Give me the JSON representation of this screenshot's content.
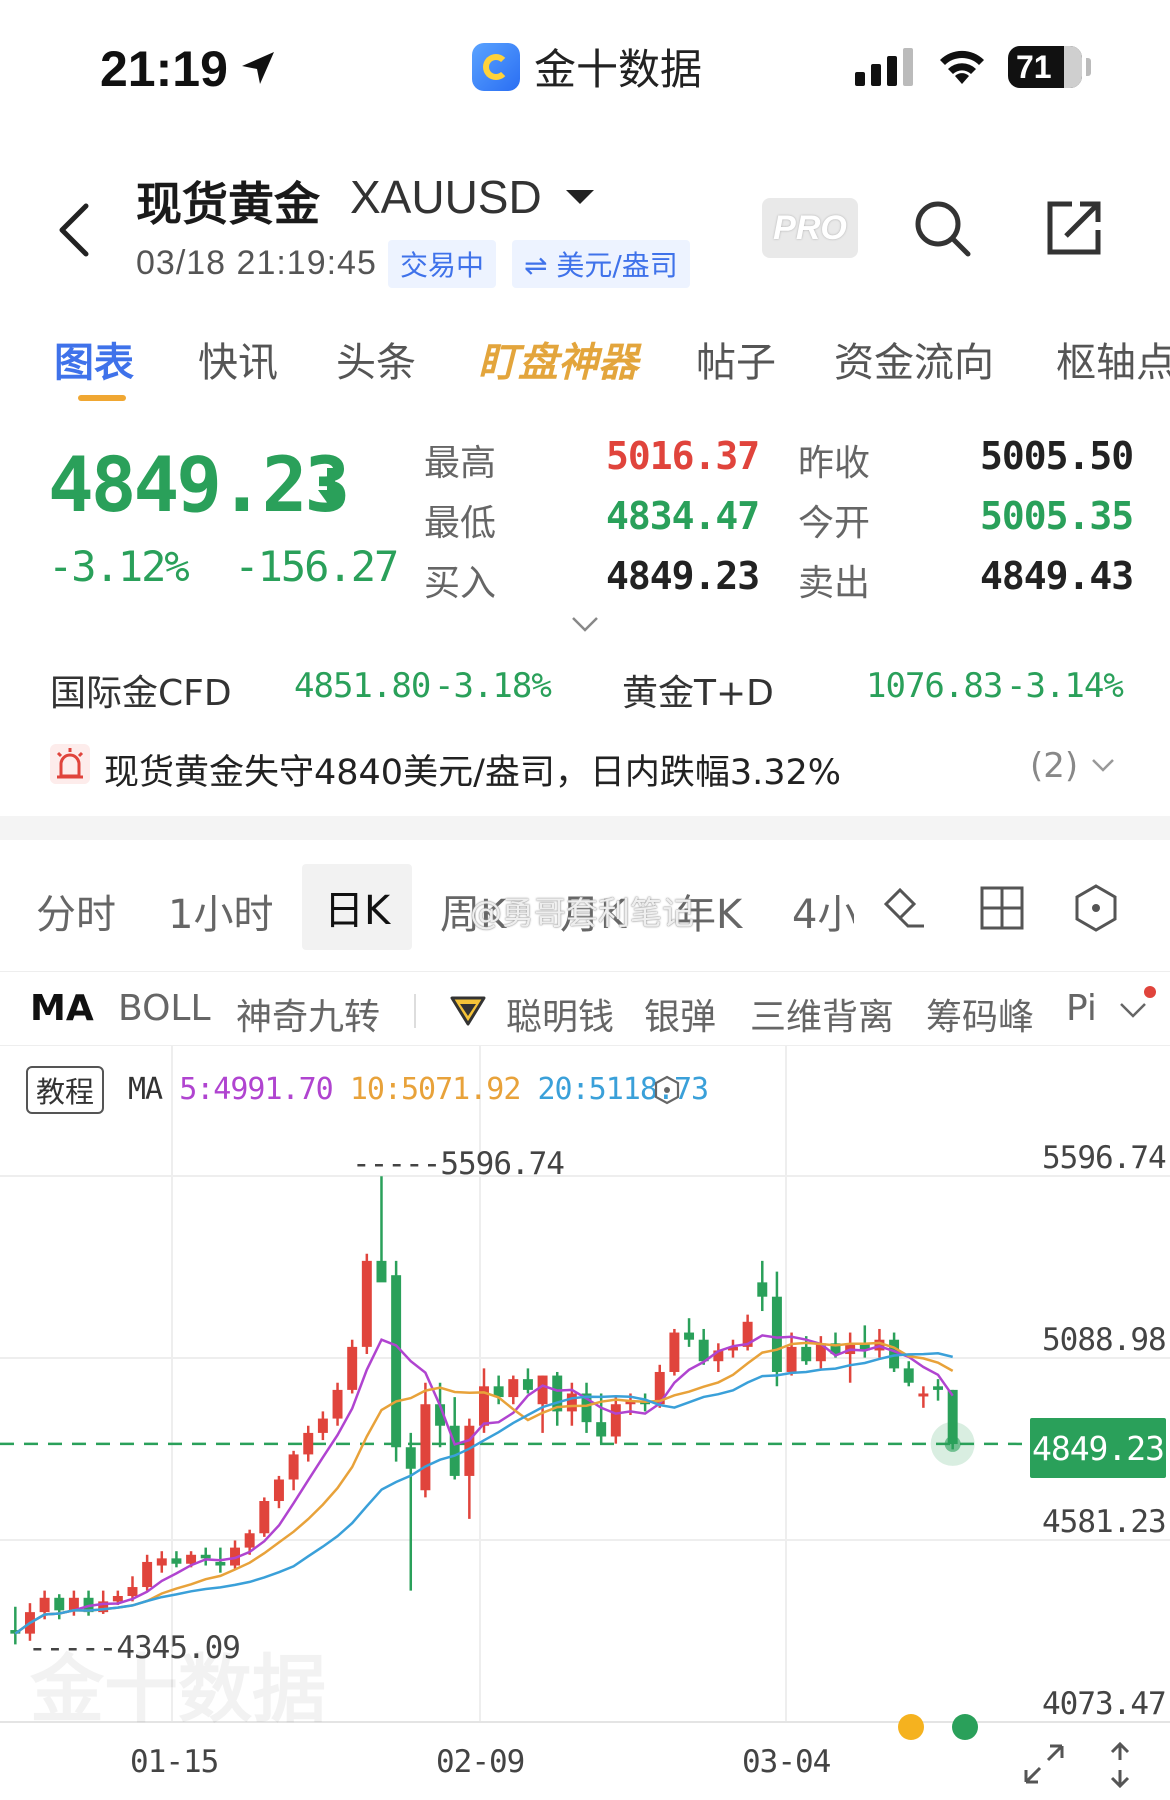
{
  "status_bar": {
    "time": "21:19",
    "app_name": "金十数据",
    "battery": "71"
  },
  "header": {
    "name": "现货黄金",
    "code": "XAUUSD",
    "datetime": "03/18 21:19:45",
    "status_tag": "交易中",
    "unit_tag": "⇌ 美元/盎司",
    "pro_label": "PRO"
  },
  "tabs": [
    {
      "label": "图表"
    },
    {
      "label": "快讯"
    },
    {
      "label": "头条"
    },
    {
      "label": "盯盘神器"
    },
    {
      "label": "帖子"
    },
    {
      "label": "资金流向"
    },
    {
      "label": "枢轴点"
    }
  ],
  "quote": {
    "price": "4849.23",
    "change_pct": "-3.12%",
    "change_abs": "-156.27",
    "stats": [
      {
        "label": "最高",
        "value": "5016.37",
        "color": "#e0443c"
      },
      {
        "label": "最低",
        "value": "4834.47",
        "color": "#2aa05a"
      },
      {
        "label": "买入",
        "value": "4849.23",
        "color": "#222222"
      },
      {
        "label": "昨收",
        "value": "5005.50",
        "color": "#222222"
      },
      {
        "label": "今开",
        "value": "5005.35",
        "color": "#2aa05a"
      },
      {
        "label": "卖出",
        "value": "4849.43",
        "color": "#222222"
      }
    ]
  },
  "related": [
    {
      "name": "国际金CFD",
      "price": "4851.80",
      "change": "-3.18%"
    },
    {
      "name": "黄金T+D",
      "price": "1076.83",
      "change": "-3.14%"
    }
  ],
  "news": {
    "text": "现货黄金失守4840美元/盎司，日内跌幅3.32%",
    "count": "(2)"
  },
  "periods": [
    {
      "label": "分时"
    },
    {
      "label": "1小时"
    },
    {
      "label": "日K"
    },
    {
      "label": "周K"
    },
    {
      "label": "月K"
    },
    {
      "label": "年K"
    },
    {
      "label": "4小"
    }
  ],
  "watermark_text": "@勇哥套利笔记",
  "indicators": [
    {
      "label": "MA"
    },
    {
      "label": "BOLL"
    },
    {
      "label": "神奇九转"
    },
    {
      "label": "聪明钱"
    },
    {
      "label": "银弹"
    },
    {
      "label": "三维背离"
    },
    {
      "label": "筹码峰"
    },
    {
      "label": "Pi"
    }
  ],
  "chart_legend": {
    "tutorial": "教程",
    "ma_label": "MA",
    "ma5": "5:4991.70",
    "ma10": "10:5071.92",
    "ma20": "20:5118.73"
  },
  "chart_watermark": "金十数据",
  "chart_data": {
    "type": "candlestick",
    "y_ticks": [
      "5596.74",
      "5088.98",
      "4581.23",
      "4073.47"
    ],
    "ylim": [
      4073.47,
      5596.74
    ],
    "x_ticks": [
      "01-15",
      "02-09",
      "03-04"
    ],
    "high_label": "5596.74",
    "low_label": "4345.09",
    "last_price": "4849.23",
    "last_price_value": 4849.23,
    "colors": {
      "up": "#e0443c",
      "down": "#2aa05a",
      "ma5": "#b044d0",
      "ma10": "#e8a23a",
      "ma20": "#3aa0d9"
    },
    "candles": [
      {
        "o": 4330,
        "h": 4395,
        "l": 4290,
        "c": 4320
      },
      {
        "o": 4320,
        "h": 4405,
        "l": 4300,
        "c": 4380
      },
      {
        "o": 4380,
        "h": 4440,
        "l": 4360,
        "c": 4420
      },
      {
        "o": 4420,
        "h": 4430,
        "l": 4360,
        "c": 4385
      },
      {
        "o": 4385,
        "h": 4440,
        "l": 4370,
        "c": 4420
      },
      {
        "o": 4420,
        "h": 4440,
        "l": 4370,
        "c": 4380
      },
      {
        "o": 4380,
        "h": 4440,
        "l": 4375,
        "c": 4410
      },
      {
        "o": 4410,
        "h": 4440,
        "l": 4400,
        "c": 4425
      },
      {
        "o": 4425,
        "h": 4480,
        "l": 4410,
        "c": 4450
      },
      {
        "o": 4450,
        "h": 4540,
        "l": 4440,
        "c": 4520
      },
      {
        "o": 4510,
        "h": 4550,
        "l": 4490,
        "c": 4530
      },
      {
        "o": 4530,
        "h": 4550,
        "l": 4505,
        "c": 4515
      },
      {
        "o": 4515,
        "h": 4550,
        "l": 4505,
        "c": 4540
      },
      {
        "o": 4540,
        "h": 4560,
        "l": 4510,
        "c": 4530
      },
      {
        "o": 4520,
        "h": 4560,
        "l": 4490,
        "c": 4510
      },
      {
        "o": 4510,
        "h": 4580,
        "l": 4500,
        "c": 4560
      },
      {
        "o": 4560,
        "h": 4610,
        "l": 4540,
        "c": 4600
      },
      {
        "o": 4600,
        "h": 4700,
        "l": 4590,
        "c": 4690
      },
      {
        "o": 4690,
        "h": 4760,
        "l": 4670,
        "c": 4750
      },
      {
        "o": 4750,
        "h": 4830,
        "l": 4720,
        "c": 4820
      },
      {
        "o": 4820,
        "h": 4900,
        "l": 4800,
        "c": 4880
      },
      {
        "o": 4880,
        "h": 4940,
        "l": 4860,
        "c": 4920
      },
      {
        "o": 4920,
        "h": 5020,
        "l": 4900,
        "c": 5000
      },
      {
        "o": 5000,
        "h": 5140,
        "l": 4990,
        "c": 5120
      },
      {
        "o": 5120,
        "h": 5380,
        "l": 5100,
        "c": 5360
      },
      {
        "o": 5360,
        "h": 5596,
        "l": 5310,
        "c": 5300
      },
      {
        "o": 5320,
        "h": 5360,
        "l": 4800,
        "c": 4840
      },
      {
        "o": 4840,
        "h": 4880,
        "l": 4440,
        "c": 4780
      },
      {
        "o": 4720,
        "h": 5020,
        "l": 4700,
        "c": 4960
      },
      {
        "o": 4960,
        "h": 5020,
        "l": 4840,
        "c": 4900
      },
      {
        "o": 4900,
        "h": 4980,
        "l": 4750,
        "c": 4760
      },
      {
        "o": 4760,
        "h": 4920,
        "l": 4640,
        "c": 4900
      },
      {
        "o": 4900,
        "h": 5060,
        "l": 4880,
        "c": 5010
      },
      {
        "o": 5010,
        "h": 5040,
        "l": 4960,
        "c": 4980
      },
      {
        "o": 4980,
        "h": 5040,
        "l": 4960,
        "c": 5030
      },
      {
        "o": 5030,
        "h": 5060,
        "l": 4990,
        "c": 5000
      },
      {
        "o": 4960,
        "h": 5040,
        "l": 4880,
        "c": 5040
      },
      {
        "o": 5040,
        "h": 5050,
        "l": 4900,
        "c": 4940
      },
      {
        "o": 4940,
        "h": 5020,
        "l": 4900,
        "c": 4990
      },
      {
        "o": 4990,
        "h": 5020,
        "l": 4880,
        "c": 4910
      },
      {
        "o": 4910,
        "h": 4990,
        "l": 4850,
        "c": 4870
      },
      {
        "o": 4870,
        "h": 4980,
        "l": 4850,
        "c": 4960
      },
      {
        "o": 4960,
        "h": 4990,
        "l": 4930,
        "c": 4970
      },
      {
        "o": 4970,
        "h": 4990,
        "l": 4940,
        "c": 4960
      },
      {
        "o": 4960,
        "h": 5070,
        "l": 4950,
        "c": 5050
      },
      {
        "o": 5050,
        "h": 5170,
        "l": 5040,
        "c": 5160
      },
      {
        "o": 5160,
        "h": 5200,
        "l": 5120,
        "c": 5140
      },
      {
        "o": 5140,
        "h": 5170,
        "l": 5070,
        "c": 5080
      },
      {
        "o": 5080,
        "h": 5130,
        "l": 5050,
        "c": 5110
      },
      {
        "o": 5110,
        "h": 5140,
        "l": 5090,
        "c": 5120
      },
      {
        "o": 5120,
        "h": 5210,
        "l": 5110,
        "c": 5190
      },
      {
        "o": 5300,
        "h": 5360,
        "l": 5220,
        "c": 5260
      },
      {
        "o": 5260,
        "h": 5330,
        "l": 5010,
        "c": 5050
      },
      {
        "o": 5050,
        "h": 5160,
        "l": 5040,
        "c": 5120
      },
      {
        "o": 5120,
        "h": 5150,
        "l": 5070,
        "c": 5080
      },
      {
        "o": 5080,
        "h": 5150,
        "l": 5060,
        "c": 5130
      },
      {
        "o": 5130,
        "h": 5160,
        "l": 5090,
        "c": 5100
      },
      {
        "o": 5100,
        "h": 5160,
        "l": 5020,
        "c": 5130
      },
      {
        "o": 5130,
        "h": 5180,
        "l": 5090,
        "c": 5110
      },
      {
        "o": 5110,
        "h": 5170,
        "l": 5090,
        "c": 5140
      },
      {
        "o": 5140,
        "h": 5160,
        "l": 5050,
        "c": 5060
      },
      {
        "o": 5060,
        "h": 5080,
        "l": 5010,
        "c": 5020
      },
      {
        "o": 4990,
        "h": 5010,
        "l": 4950,
        "c": 4990
      },
      {
        "o": 5010,
        "h": 5030,
        "l": 4970,
        "c": 5000
      },
      {
        "o": 5000,
        "h": 5000,
        "l": 4834,
        "c": 4849
      }
    ]
  }
}
